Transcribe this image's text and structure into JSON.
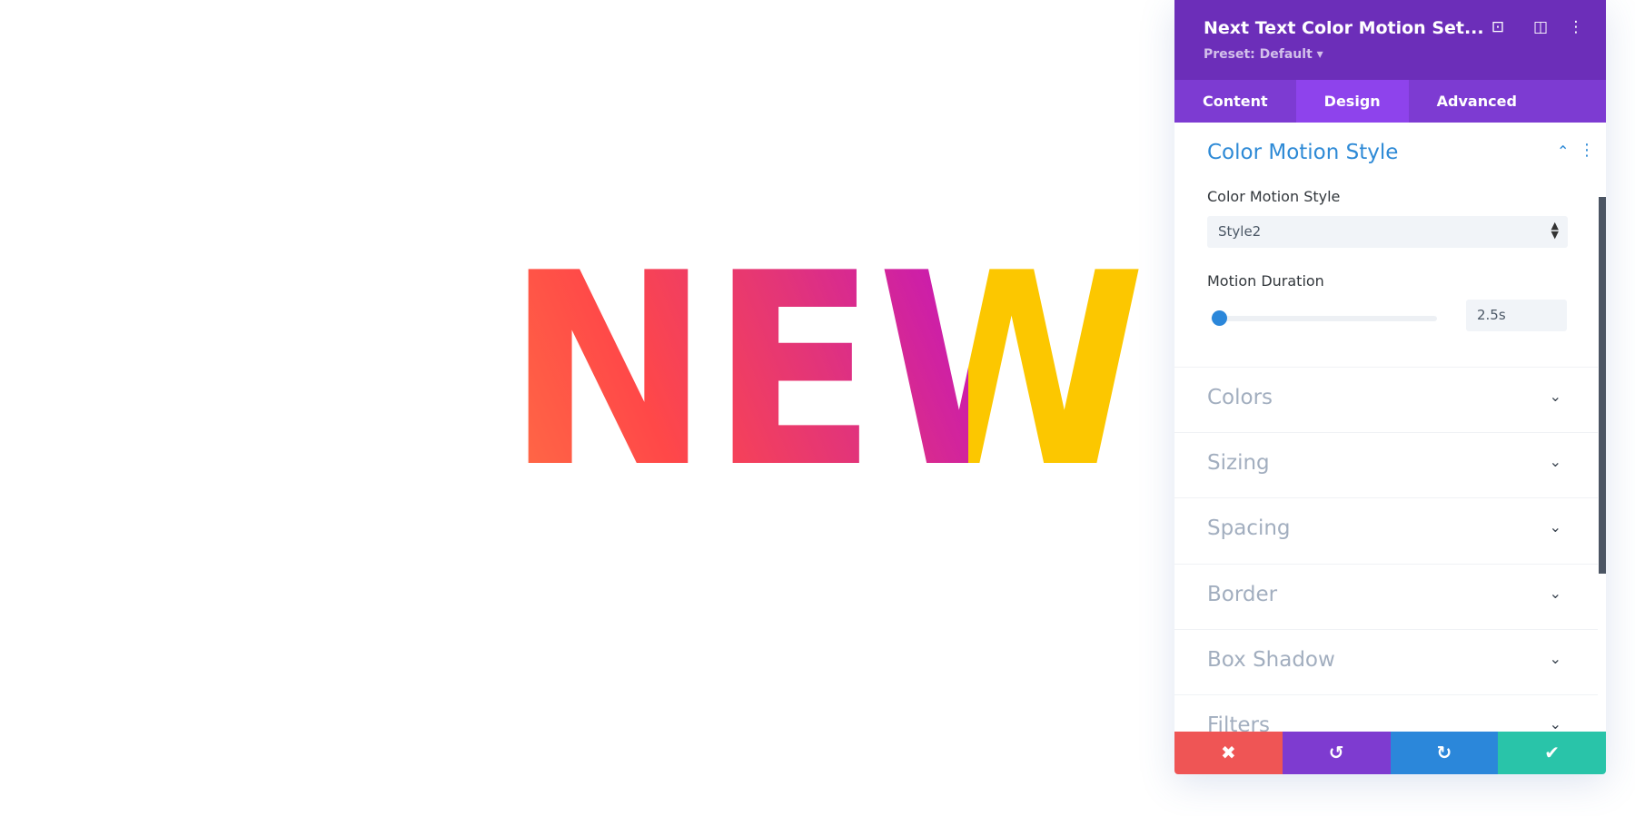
{
  "canvas": {
    "word": "NEW",
    "gradient_colors": [
      "#ff6a45",
      "#ff4848",
      "#e2347a",
      "#c517b8"
    ],
    "highlight_color": "#fcc700"
  },
  "panel": {
    "title": "Next Text Color Motion Set...",
    "preset": "Preset: Default ▾",
    "header_icons": [
      "focus-icon",
      "split-view-icon",
      "more-vertical-icon"
    ],
    "tabs": [
      {
        "label": "Content"
      },
      {
        "label": "Design",
        "active": true
      },
      {
        "label": "Advanced"
      }
    ],
    "section": {
      "title": "Color Motion Style",
      "style_label": "Color Motion Style",
      "style_value": "Style2",
      "duration_label": "Motion Duration",
      "duration_value": "2.5s",
      "duration_slider_fraction": 0.02
    },
    "groups": [
      "Colors",
      "Sizing",
      "Spacing",
      "Border",
      "Box Shadow",
      "Filters"
    ],
    "footer": {
      "colors": [
        "#ef5555",
        "#7e3bd0",
        "#2b87da",
        "#29c4a9"
      ]
    }
  },
  "colors": {
    "header": "#6c2eb9",
    "tabs": "#7d3bd2",
    "active_tab": "#8e43ec",
    "accent": "#2e8ad6"
  }
}
